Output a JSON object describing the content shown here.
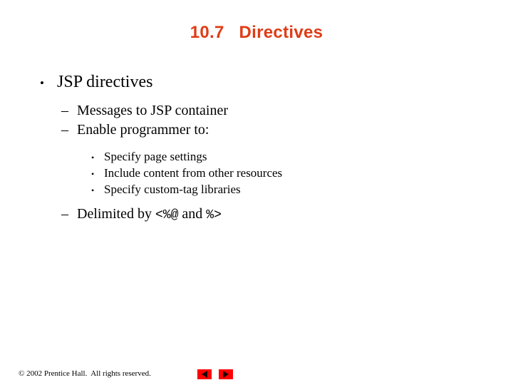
{
  "slide": {
    "title": "10.7   Directives",
    "title_color": "#E03C16",
    "background_color": "#FFFFFF",
    "outline": {
      "level1": {
        "marker": "•",
        "text": "JSP directives"
      },
      "level2_first": {
        "marker": "–",
        "text": "Messages to JSP container"
      },
      "level2_second": {
        "marker": "–",
        "text": "Enable programmer to:"
      },
      "level3": [
        {
          "marker": "•",
          "text": "Specify page settings"
        },
        {
          "marker": "•",
          "text": "Include content from other resources"
        },
        {
          "marker": "•",
          "text": "Specify custom-tag libraries"
        }
      ],
      "level2_third": {
        "marker": "–",
        "text_before": "Delimited by ",
        "code_open": "<%@",
        "text_middle": " and ",
        "code_close": "%>"
      }
    }
  },
  "footer": {
    "copyright": "© 2002 Prentice Hall.  All rights reserved.",
    "nav": {
      "previous_icon": "triangle-left-icon",
      "next_icon": "triangle-right-icon",
      "button_color": "#FF0000"
    }
  }
}
